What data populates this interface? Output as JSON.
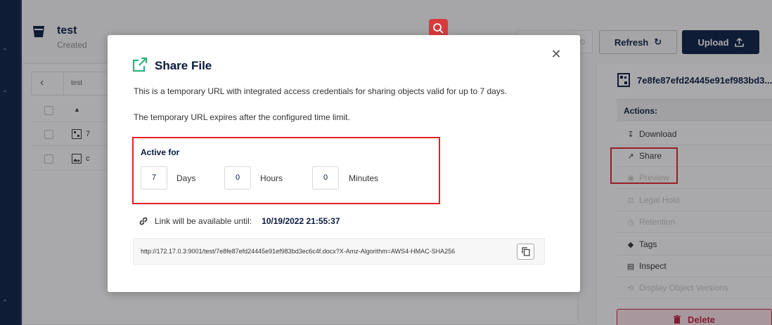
{
  "app": {
    "bucket_title": "test",
    "bucket_sub": "Created",
    "rewind_label": "d",
    "refresh_label": "Refresh",
    "upload_label": "Upload",
    "breadcrumb": "test"
  },
  "object_list": {
    "rows": [
      {
        "name": "7",
        "icon": "qr-file-icon"
      },
      {
        "name": "c",
        "icon": "image-file-icon"
      }
    ]
  },
  "object_panel": {
    "object_name": "7e8fe87efd24445e91ef983bd3...",
    "actions_title": "Actions:",
    "actions": [
      {
        "label": "Download",
        "icon": "download-icon",
        "enabled": true
      },
      {
        "label": "Share",
        "icon": "share-icon",
        "enabled": true
      },
      {
        "label": "Preview",
        "icon": "preview-icon",
        "enabled": false
      },
      {
        "label": "Legal Hold",
        "icon": "legal-hold-icon",
        "enabled": false
      },
      {
        "label": "Retention",
        "icon": "retention-icon",
        "enabled": false
      },
      {
        "label": "Tags",
        "icon": "tag-icon",
        "enabled": true
      },
      {
        "label": "Inspect",
        "icon": "inspect-icon",
        "enabled": true
      },
      {
        "label": "Display Object Versions",
        "icon": "versions-icon",
        "enabled": false
      }
    ],
    "delete_label": "Delete"
  },
  "modal": {
    "title": "Share File",
    "description_1": "This is a temporary URL with integrated access credentials for sharing objects valid for up to 7 days.",
    "description_2": "The temporary URL expires after the configured time limit.",
    "active_for_label": "Active for",
    "days_value": "7",
    "days_label": "Days",
    "hours_value": "0",
    "hours_label": "Hours",
    "minutes_value": "0",
    "minutes_label": "Minutes",
    "available_until_label": "Link will be available until:",
    "available_until_value": "10/19/2022 21:55:37",
    "url": "http://172.17.0.3:9001/test/7e8fe87efd24445e91ef983bd3ec6c4f.docx?X-Amz-Algorithm=AWS4-HMAC-SHA256"
  },
  "colors": {
    "highlight": "#e4202a",
    "navy": "#081c42",
    "accent_green": "#2eb47b",
    "delete_red": "#c51b3f"
  }
}
